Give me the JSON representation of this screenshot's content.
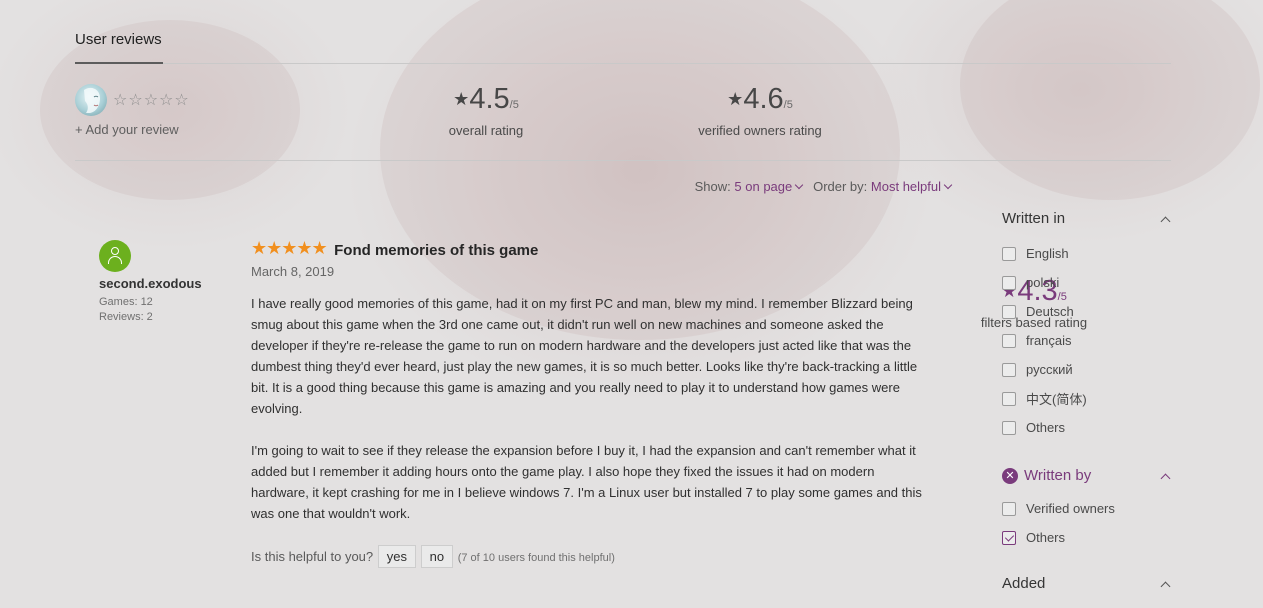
{
  "tabs": {
    "active": "User reviews"
  },
  "summary": {
    "add_review": "+ Add your review",
    "empty_stars": "☆☆☆☆☆",
    "ratings": [
      {
        "value": "4.5",
        "of": "/5",
        "label": "overall rating"
      },
      {
        "value": "4.6",
        "of": "/5",
        "label": "verified owners rating"
      },
      {
        "value": "4.3",
        "of": "/5",
        "label": "filters based rating"
      }
    ]
  },
  "sort": {
    "show_label": "Show:",
    "show_value": "5 on page",
    "order_label": "Order by:",
    "order_value": "Most helpful"
  },
  "review": {
    "user": {
      "name": "second.exodous",
      "games": "Games: 12",
      "reviews": "Reviews: 2"
    },
    "rating_stars": 5,
    "title": "Fond memories of this game",
    "date": "March 8, 2019",
    "paragraphs": [
      "I have really good memories of this game, had it on my first PC and man, blew my mind. I remember Blizzard being smug about this game when the 3rd one came out, it didn't run well on new machines and someone asked the developer if they're re-release the game to run on modern hardware and the developers just acted like that was the dumbest thing they'd ever heard, just play the new games, it is so much better. Looks like thy're back-tracking a little bit. It is a good thing because this game is amazing and you really need to play it to understand how games were evolving.",
      "I'm going to wait to see if they release the expansion before I buy it, I had the expansion and can't remember what it added but I remember it adding hours onto the game play. I also hope they fixed the issues it had on modern hardware, it kept crashing for me in I believe windows 7. I'm a Linux user but installed 7 to play some games and this was one that wouldn't work."
    ],
    "helpful_prompt": "Is this helpful to you?",
    "yes_label": "yes",
    "no_label": "no",
    "helpful_count": "(7 of 10 users found this helpful)"
  },
  "filters": {
    "written_in": {
      "title": "Written in",
      "options": [
        {
          "label": "English",
          "checked": false
        },
        {
          "label": "polski",
          "checked": false
        },
        {
          "label": "Deutsch",
          "checked": false
        },
        {
          "label": "français",
          "checked": false
        },
        {
          "label": "русский",
          "checked": false
        },
        {
          "label": "中文(简体)",
          "checked": false
        },
        {
          "label": "Others",
          "checked": false
        }
      ]
    },
    "written_by": {
      "title": "Written by",
      "options": [
        {
          "label": "Verified owners",
          "checked": false
        },
        {
          "label": "Others",
          "checked": true
        }
      ]
    },
    "added": {
      "title": "Added"
    }
  },
  "colors": {
    "accent": "#7a3b7c",
    "star_gold": "#f18f1e",
    "avatar_green": "#6cb01e"
  }
}
